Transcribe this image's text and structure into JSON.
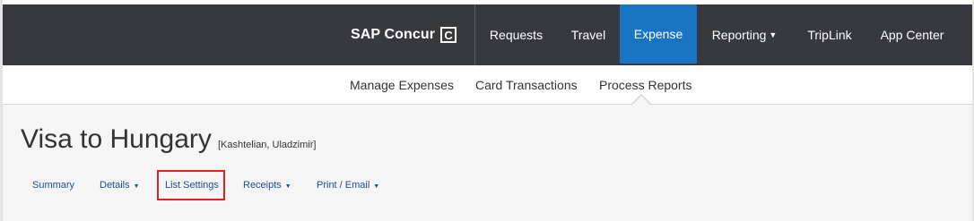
{
  "header": {
    "brand": "SAP Concur",
    "brand_mark": "C",
    "nav": [
      {
        "label": "Requests"
      },
      {
        "label": "Travel"
      },
      {
        "label": "Expense",
        "active": true
      },
      {
        "label": "Reporting",
        "has_caret": true
      },
      {
        "label": "TripLink"
      },
      {
        "label": "App Center"
      }
    ],
    "colors": {
      "bar": "#37393f",
      "active": "#1a74c4"
    }
  },
  "subnav": {
    "items": [
      {
        "label": "Manage Expenses"
      },
      {
        "label": "Card Transactions"
      },
      {
        "label": "Process Reports",
        "active": true
      }
    ]
  },
  "report": {
    "title": "Visa to Hungary",
    "owner": "[Kashtelian, Uladzimir]",
    "tabs": [
      {
        "label": "Summary"
      },
      {
        "label": "Details",
        "has_caret": true
      },
      {
        "label": "List Settings",
        "highlighted": true
      },
      {
        "label": "Receipts",
        "has_caret": true
      },
      {
        "label": "Print / Email",
        "has_caret": true
      }
    ]
  },
  "icons": {
    "caret": "caret-down-icon"
  },
  "highlight_color": "#e02020"
}
